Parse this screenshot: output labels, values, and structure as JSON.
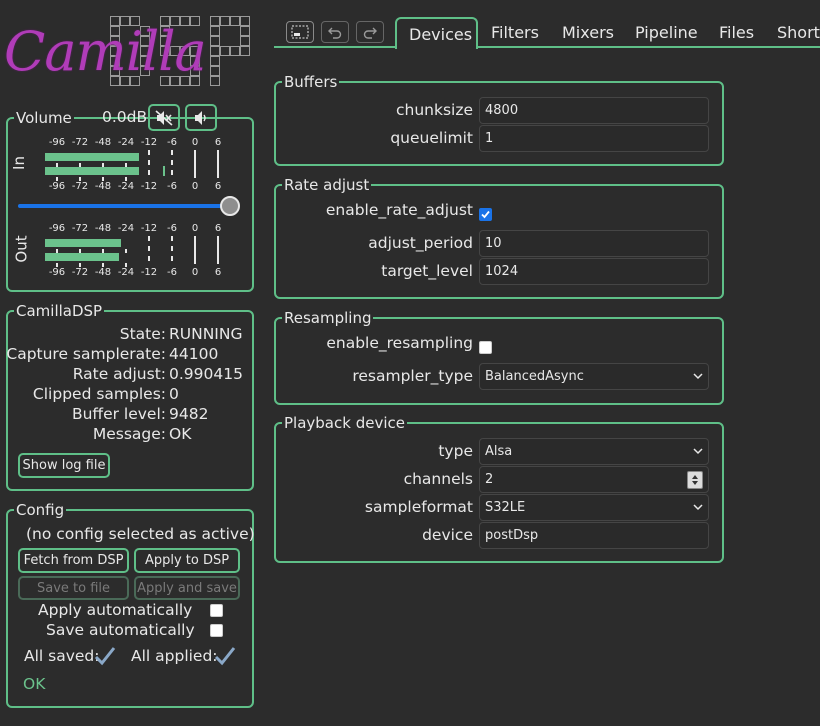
{
  "logo": {
    "text": "Camilla",
    "mark": "DSP"
  },
  "toolbar": {
    "icons": [
      "select-area-icon",
      "undo-icon",
      "redo-icon"
    ]
  },
  "tabs": [
    "Devices",
    "Filters",
    "Mixers",
    "Pipeline",
    "Files",
    "Shortcuts"
  ],
  "volume": {
    "legend": "Volume",
    "value": "0.0dB",
    "in_label": "In",
    "out_label": "Out",
    "ticks": [
      "-96",
      "-72",
      "-48",
      "-24",
      "-12",
      "-6",
      "0",
      "6"
    ],
    "slider_fraction": 1.0
  },
  "camilladsp": {
    "legend": "CamillaDSP",
    "rows": [
      {
        "label": "State:",
        "value": "RUNNING"
      },
      {
        "label": "Capture samplerate:",
        "value": "44100"
      },
      {
        "label": "Rate adjust:",
        "value": "0.990415"
      },
      {
        "label": "Clipped samples:",
        "value": "0"
      },
      {
        "label": "Buffer level:",
        "value": "9482"
      },
      {
        "label": "Message:",
        "value": "OK"
      }
    ],
    "show_log": "Show log file"
  },
  "config": {
    "legend": "Config",
    "status": "(no config selected as active)",
    "fetch": "Fetch from DSP",
    "apply": "Apply to DSP",
    "save_file": "Save to file",
    "apply_save": "Apply and save",
    "apply_auto": "Apply automatically",
    "save_auto": "Save automatically",
    "all_saved": "All saved:",
    "all_applied": "All applied:",
    "ok": "OK"
  },
  "buffers": {
    "legend": "Buffers",
    "chunksize_label": "chunksize",
    "chunksize": "4800",
    "queuelimit_label": "queuelimit",
    "queuelimit": "1"
  },
  "rate_adjust": {
    "legend": "Rate adjust",
    "enable_label": "enable_rate_adjust",
    "enable": true,
    "period_label": "adjust_period",
    "period": "10",
    "target_label": "target_level",
    "target": "1024"
  },
  "resampling": {
    "legend": "Resampling",
    "enable_label": "enable_resampling",
    "enable": false,
    "type_label": "resampler_type",
    "type": "BalancedAsync"
  },
  "playback": {
    "legend": "Playback device",
    "type_label": "type",
    "type": "Alsa",
    "channels_label": "channels",
    "channels": "2",
    "format_label": "sampleformat",
    "format": "S32LE",
    "device_label": "device",
    "device": "postDsp"
  }
}
